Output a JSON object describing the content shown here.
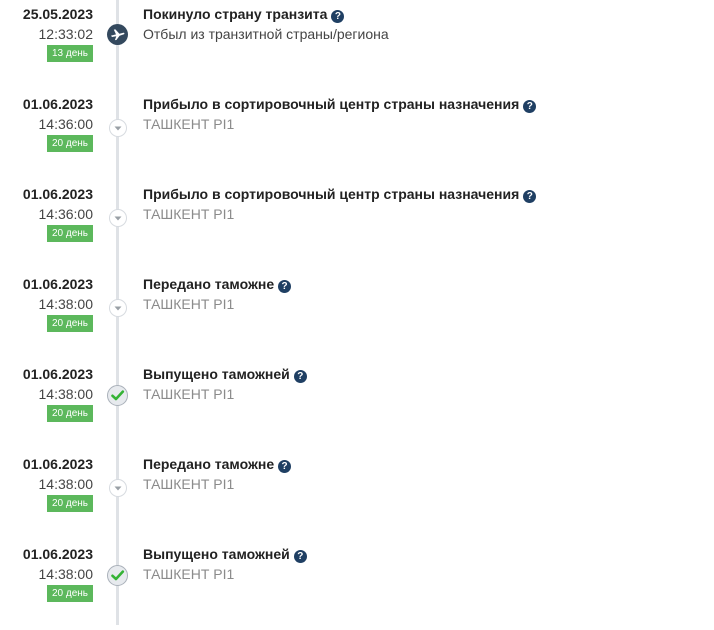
{
  "colors": {
    "badge": "#5cb85c",
    "help_icon": "#1f3f63",
    "node_dark": "#34495e",
    "check": "#35b335",
    "track": "#dfe2e6"
  },
  "events": [
    {
      "date": "25.05.2023",
      "time": "12:33:02",
      "days": "13 день",
      "title": "Покинуло страну транзита",
      "location": "Отбыл из транзитной страны/региона",
      "icon": "airplane-icon",
      "help_icon": "?"
    },
    {
      "date": "01.06.2023",
      "time": "14:36:00",
      "days": "20 день",
      "title": "Прибыло в сортировочный центр страны назначения",
      "location": "ТАШКЕНТ PI1",
      "icon": "chevron-down-icon",
      "help_icon": "?"
    },
    {
      "date": "01.06.2023",
      "time": "14:36:00",
      "days": "20 день",
      "title": "Прибыло в сортировочный центр страны назначения",
      "location": "ТАШКЕНТ PI1",
      "icon": "chevron-down-icon",
      "help_icon": "?"
    },
    {
      "date": "01.06.2023",
      "time": "14:38:00",
      "days": "20 день",
      "title": "Передано таможне",
      "location": "ТАШКЕНТ PI1",
      "icon": "chevron-down-icon",
      "help_icon": "?"
    },
    {
      "date": "01.06.2023",
      "time": "14:38:00",
      "days": "20 день",
      "title": "Выпущено таможней",
      "location": "ТАШКЕНТ PI1",
      "icon": "checkmark-icon",
      "help_icon": "?"
    },
    {
      "date": "01.06.2023",
      "time": "14:38:00",
      "days": "20 день",
      "title": "Передано таможне",
      "location": "ТАШКЕНТ PI1",
      "icon": "chevron-down-icon",
      "help_icon": "?"
    },
    {
      "date": "01.06.2023",
      "time": "14:38:00",
      "days": "20 день",
      "title": "Выпущено таможней",
      "location": "ТАШКЕНТ PI1",
      "icon": "checkmark-icon",
      "help_icon": "?"
    }
  ]
}
